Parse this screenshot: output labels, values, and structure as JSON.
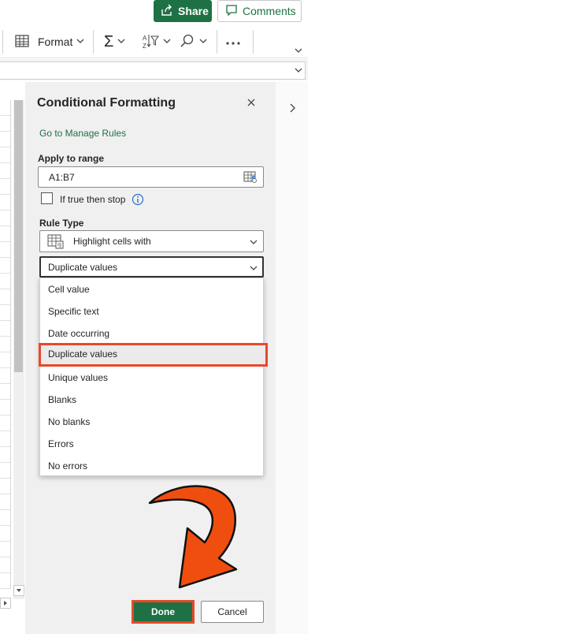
{
  "toolbar": {
    "share_label": "Share",
    "comments_label": "Comments",
    "format_label": "Format"
  },
  "panel": {
    "title": "Conditional Formatting",
    "manage_rules_link": "Go to Manage Rules",
    "apply_range_label": "Apply to range",
    "apply_range_value": "A1:B7",
    "stop_checkbox_label": "If true then stop",
    "stop_checkbox_checked": false,
    "rule_type_label": "Rule Type",
    "rule_type_value": "Highlight cells with",
    "condition_value": "Duplicate values",
    "condition_options": [
      "Cell value",
      "Specific text",
      "Date occurring",
      "Duplicate values",
      "Unique values",
      "Blanks",
      "No blanks",
      "Errors",
      "No errors"
    ],
    "selected_option_index": 3,
    "done_label": "Done",
    "cancel_label": "Cancel"
  },
  "colors": {
    "accent_green": "#1e7145",
    "highlight_orange": "#e8492a",
    "arrow_fill": "#f04e0e"
  }
}
